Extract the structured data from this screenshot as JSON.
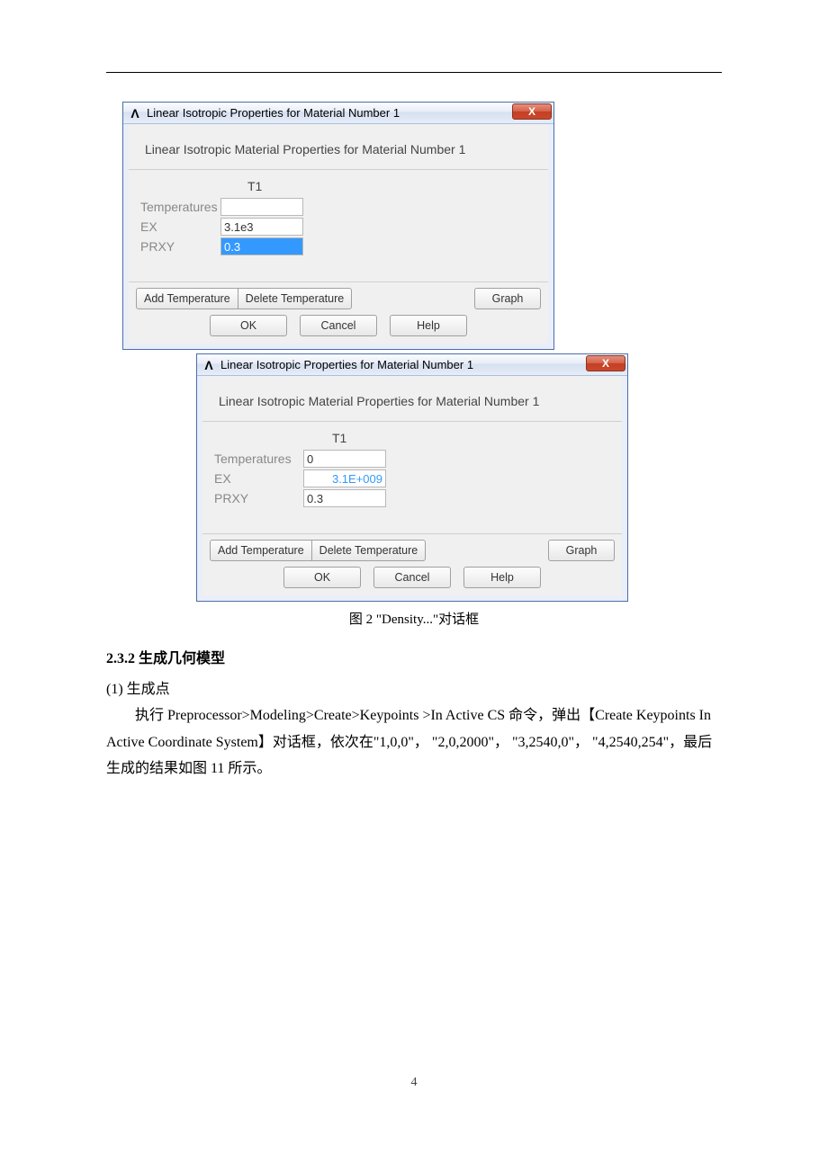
{
  "dialog1": {
    "title": "Linear Isotropic Properties for Material Number 1",
    "close": "X",
    "header": "Linear Isotropic Material Properties for Material Number 1",
    "col": "T1",
    "rows": {
      "temperatures": {
        "label": "Temperatures",
        "value": ""
      },
      "ex": {
        "label": "EX",
        "value": "3.1e3"
      },
      "prxy": {
        "label": "PRXY",
        "value": "0.3"
      }
    },
    "buttons": {
      "add_temp": "Add Temperature",
      "del_temp": "Delete Temperature",
      "graph": "Graph",
      "ok": "OK",
      "cancel": "Cancel",
      "help": "Help"
    }
  },
  "dialog2": {
    "title": "Linear Isotropic Properties for Material Number 1",
    "close": "X",
    "header": "Linear Isotropic Material Properties for Material Number 1",
    "col": "T1",
    "rows": {
      "temperatures": {
        "label": "Temperatures",
        "value": "0"
      },
      "ex": {
        "label": "EX",
        "value": "3.1E+009"
      },
      "prxy": {
        "label": "PRXY",
        "value": "0.3"
      }
    },
    "buttons": {
      "add_temp": "Add Temperature",
      "del_temp": "Delete Temperature",
      "graph": "Graph",
      "ok": "OK",
      "cancel": "Cancel",
      "help": "Help"
    }
  },
  "caption": "图 2  \"Density...\"对话框",
  "section": {
    "heading": "2.3.2  生成几何模型",
    "item1": "(1) 生成点",
    "para": "执行 Preprocessor>Modeling>Create>Keypoints >In Active CS 命令，弹出【Create Keypoints In Active Coordinate System】对话框，依次在\"1,0,0\"， \"2,0,2000\"，  \"3,2540,0\"， \"4,2540,254\"，最后生成的结果如图 11 所示。"
  },
  "page_number": "4"
}
